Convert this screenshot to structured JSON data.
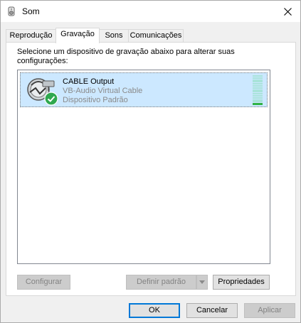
{
  "window": {
    "title": "Som"
  },
  "tabs": [
    {
      "label": "Reprodução",
      "active": false
    },
    {
      "label": "Gravação",
      "active": true
    },
    {
      "label": "Sons",
      "active": false
    },
    {
      "label": "Comunicações",
      "active": false
    }
  ],
  "panel": {
    "instruction": "Selecione um dispositivo de gravação abaixo para alterar suas configurações:",
    "devices": [
      {
        "name": "CABLE Output",
        "driver": "VB-Audio Virtual Cable",
        "status": "Dispositivo Padrão",
        "icon": "cable-recording-icon",
        "default_badge": "check-icon",
        "selected": true,
        "level_meter": {
          "segments": 15,
          "level": 0.07
        }
      }
    ],
    "buttons": {
      "configure": "Configurar",
      "set_default": "Definir padrão",
      "properties": "Propriedades"
    }
  },
  "footer": {
    "ok": "OK",
    "cancel": "Cancelar",
    "apply": "Aplicar"
  },
  "colors": {
    "selection": "#cce8ff",
    "accent": "#0078d7",
    "check_green": "#2fa84f",
    "meter_off": "#a9e3da",
    "meter_on": "#2fb344"
  }
}
